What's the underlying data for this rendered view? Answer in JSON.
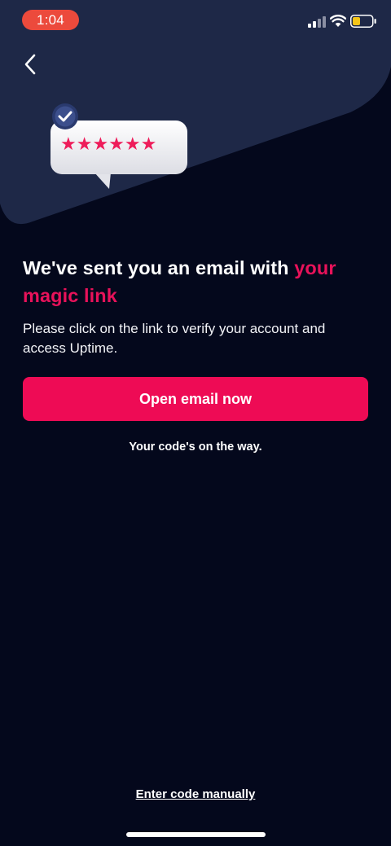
{
  "status_bar": {
    "time": "1:04",
    "icons": [
      "signal-icon",
      "wifi-icon",
      "battery-icon"
    ]
  },
  "nav": {
    "back_icon": "chevron-left-icon"
  },
  "hero": {
    "illustration": "speech-bubble-password-icon",
    "badge_icon": "check-icon"
  },
  "content": {
    "headline_main": "We've sent you an email with ",
    "headline_accent": "your magic link",
    "subtext": "Please click on the link to verify your account and access Uptime."
  },
  "actions": {
    "primary_label": "Open email now",
    "note": "Your code's on the way.",
    "manual_link": "Enter code manually"
  },
  "colors": {
    "background": "#04081c",
    "header_panel": "#1e2847",
    "accent": "#e8125a",
    "button": "#ee0b55",
    "time_pill": "#ec4a3c",
    "battery_level": "#f5c518"
  }
}
